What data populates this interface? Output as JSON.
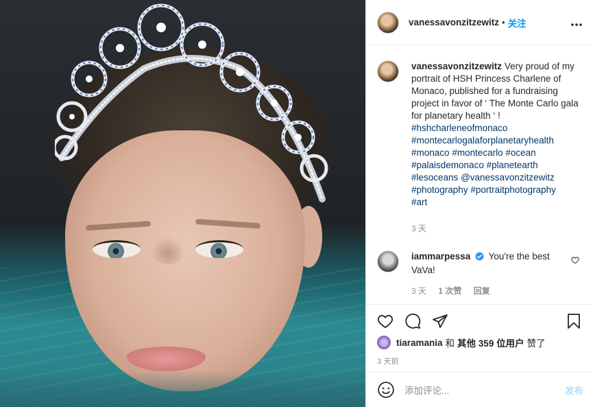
{
  "post": {
    "image_alt": "portrait photo",
    "header": {
      "username": "vanessavonzitzewitz",
      "dot": "•",
      "follow_label": "关注",
      "more_label": "•••"
    },
    "caption": {
      "username": "vanessavonzitzewitz",
      "text": "Very proud of my portrait of HSH Princess Charlene of Monaco, published for a fundraising project in favor of ‘ The Monte Carlo gala for planetary health ‘ !",
      "tags": [
        "#hshcharleneofmonaco",
        "#montecarlogalaforplanetaryhealth",
        "#monaco",
        "#montecarlo",
        "#ocean",
        "#palaisdemonaco",
        "#planetearth",
        "#lesoceans",
        "@vanessavonzitzewitz",
        "#photography",
        "#portraitphotography",
        "#art"
      ],
      "time": "3 天"
    },
    "comment": {
      "username": "iammarpessa",
      "text": "You're the best VaVa!",
      "time": "3 天",
      "likes": "1 次赞",
      "reply_label": "回复"
    },
    "likes": {
      "user": "tiaramania",
      "and_label": "和",
      "others_label": "其他 359 位用户",
      "liked_label": "赞了"
    },
    "posted_ago": "3 天前",
    "add_comment": {
      "placeholder": "添加评论...",
      "post_label": "发布"
    },
    "colors": {
      "accent": "#0095f6",
      "hashtag": "#00376b",
      "muted": "#8e8e8e",
      "post_disabled": "#b2dffc",
      "verified": "#3897f0"
    },
    "icons": [
      "heart-icon",
      "comment-icon",
      "share-icon",
      "bookmark-icon",
      "emoji-icon",
      "verified-badge-icon",
      "more-icon"
    ]
  }
}
